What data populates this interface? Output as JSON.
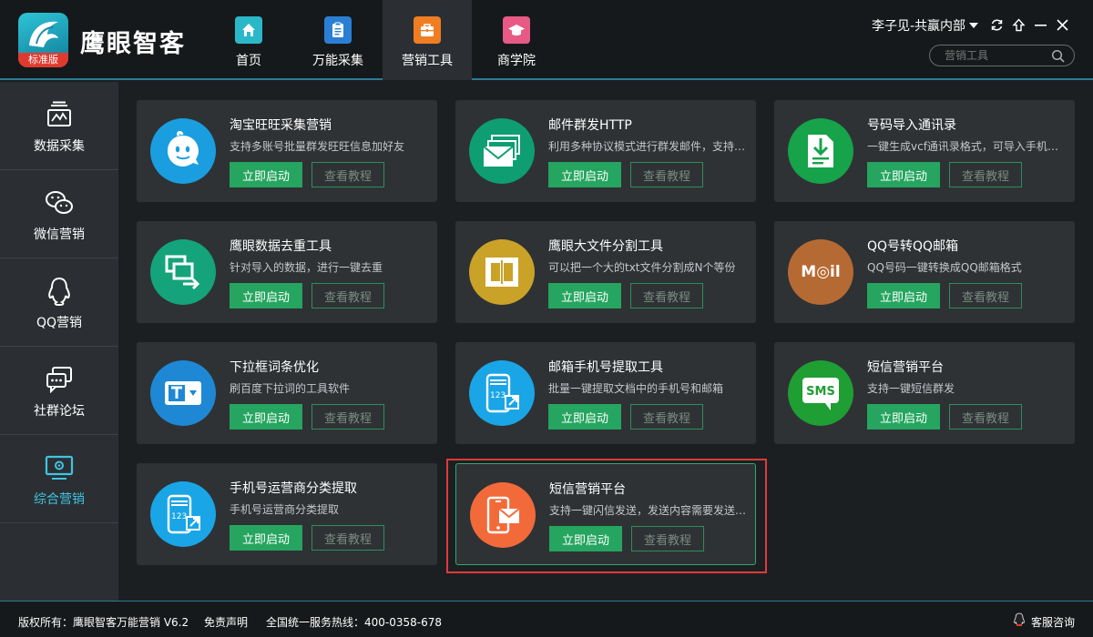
{
  "app": {
    "brand": "鹰眼智客",
    "edition_badge": "标准版"
  },
  "nav": [
    {
      "label": "首页",
      "icon": "home-icon",
      "color": "#2ab8c9"
    },
    {
      "label": "万能采集",
      "icon": "clipboard-icon",
      "color": "#2a7fd4"
    },
    {
      "label": "营销工具",
      "icon": "briefcase-icon",
      "color": "#f07d22",
      "active": true
    },
    {
      "label": "商学院",
      "icon": "graduation-cap-icon",
      "color": "#e85a86"
    }
  ],
  "user": {
    "name": "李子见-共赢内部"
  },
  "search": {
    "placeholder": "营销工具"
  },
  "sidebar": [
    {
      "label": "数据采集",
      "icon": "chart-tray-icon"
    },
    {
      "label": "微信营销",
      "icon": "wechat-icon"
    },
    {
      "label": "QQ营销",
      "icon": "qq-penguin-icon"
    },
    {
      "label": "社群论坛",
      "icon": "chat-bubbles-icon"
    },
    {
      "label": "综合营销",
      "icon": "monitor-icon",
      "active": true
    }
  ],
  "buttons": {
    "start": "立即启动",
    "tutorial": "查看教程"
  },
  "tools": [
    {
      "title": "淘宝旺旺采集营销",
      "desc": "支持多账号批量群发旺旺信息加好友",
      "icon": "wangwang-icon",
      "color": "#1a9ee0"
    },
    {
      "title": "邮件群发HTTP",
      "desc": "利用多种协议模式进行群发邮件，支持多种格式",
      "icon": "envelopes-icon",
      "color": "#0e9e72"
    },
    {
      "title": "号码导入通讯录",
      "desc": "一键生成vcf通讯录格式，可导入手机通讯录",
      "icon": "import-doc-icon",
      "color": "#16a34a"
    },
    {
      "title": "鹰眼数据去重工具",
      "desc": "针对导入的数据，进行一键去重",
      "icon": "dedupe-icon",
      "color": "#14a37a"
    },
    {
      "title": "鹰眼大文件分割工具",
      "desc": "可以把一个大的txt文件分割成N个等份",
      "icon": "split-file-icon",
      "color": "#c9a227"
    },
    {
      "title": "QQ号转QQ邮箱",
      "desc": "QQ号码一键转换成QQ邮箱格式",
      "icon": "mail-text-icon",
      "color": "#b66a33",
      "icon_text": "M◎il"
    },
    {
      "title": "下拉框词条优化",
      "desc": "刷百度下拉词的工具软件",
      "icon": "dropdown-icon",
      "color": "#1e88d4"
    },
    {
      "title": "邮箱手机号提取工具",
      "desc": "批量一键提取文档中的手机号和邮箱",
      "icon": "phone-extract-icon",
      "color": "#1aa5e6"
    },
    {
      "title": "短信营销平台",
      "desc": "支持一键短信群发",
      "icon": "sms-icon",
      "color": "#1f9e33",
      "icon_text": "SMS"
    },
    {
      "title": "手机号运营商分类提取",
      "desc": "手机号运营商分类提取",
      "icon": "phone-extract-icon",
      "color": "#1aa5e6"
    },
    {
      "title": "短信营销平台",
      "desc": "支持一键闪信发送，发送内容需要发送至手机",
      "icon": "phone-mail-icon",
      "color": "#f26a3a",
      "selected": true
    }
  ],
  "footer": {
    "copyright": "版权所有：鹰眼智客万能营销 V6.2",
    "disclaimer": "免责声明",
    "hotline": "全国统一服务热线：400-0358-678",
    "support": "客服咨询"
  }
}
